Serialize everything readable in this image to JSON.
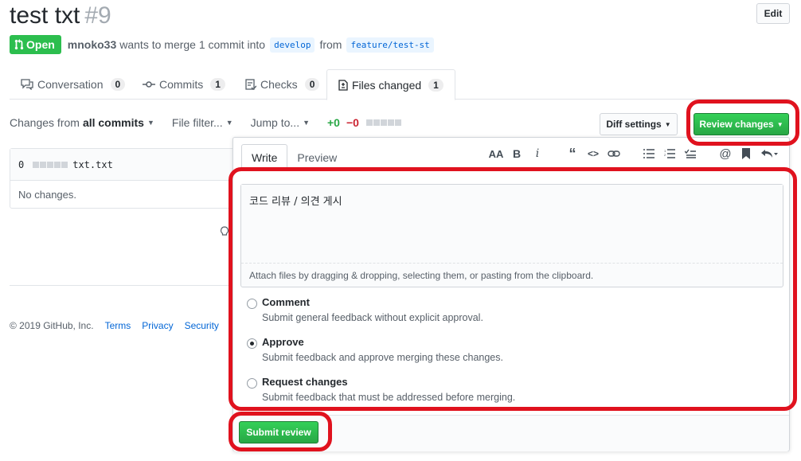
{
  "header": {
    "title": "test txt",
    "number": "#9",
    "edit_label": "Edit"
  },
  "meta": {
    "state": "Open",
    "author": "mnoko33",
    "text_merge": "wants to merge 1 commit into",
    "base_branch": "develop",
    "text_from": "from",
    "head_branch": "feature/test-st"
  },
  "tabs": [
    {
      "label": "Conversation",
      "count": "0",
      "icon": "comment-icon"
    },
    {
      "label": "Commits",
      "count": "1",
      "icon": "commit-icon"
    },
    {
      "label": "Checks",
      "count": "0",
      "icon": "checklist-icon"
    },
    {
      "label": "Files changed",
      "count": "1",
      "icon": "file-diff-icon"
    }
  ],
  "toolbar": {
    "changes_from_prefix": "Changes from",
    "changes_from_value": "all commits",
    "file_filter": "File filter...",
    "jump_to": "Jump to...",
    "additions": "+0",
    "deletions": "−0",
    "diff_settings": "Diff settings",
    "review_changes": "Review changes"
  },
  "file": {
    "count": "0",
    "name": "txt.txt",
    "body": "No changes."
  },
  "footer": {
    "copyright": "© 2019 GitHub, Inc.",
    "links": [
      "Terms",
      "Privacy",
      "Security"
    ]
  },
  "review": {
    "tabs": [
      "Write",
      "Preview"
    ],
    "comment_text": "코드 리뷰 / 의견 게시",
    "attach_hint": "Attach files by dragging & dropping, selecting them, or pasting from the clipboard.",
    "options": [
      {
        "label": "Comment",
        "desc": "Submit general feedback without explicit approval.",
        "selected": false
      },
      {
        "label": "Approve",
        "desc": "Submit feedback and approve merging these changes.",
        "selected": true
      },
      {
        "label": "Request changes",
        "desc": "Submit feedback that must be addressed before merging.",
        "selected": false
      }
    ],
    "submit_label": "Submit review"
  },
  "colors": {
    "green": "#2cbe4e",
    "highlight": "#e0121e",
    "link": "#0366d6"
  }
}
